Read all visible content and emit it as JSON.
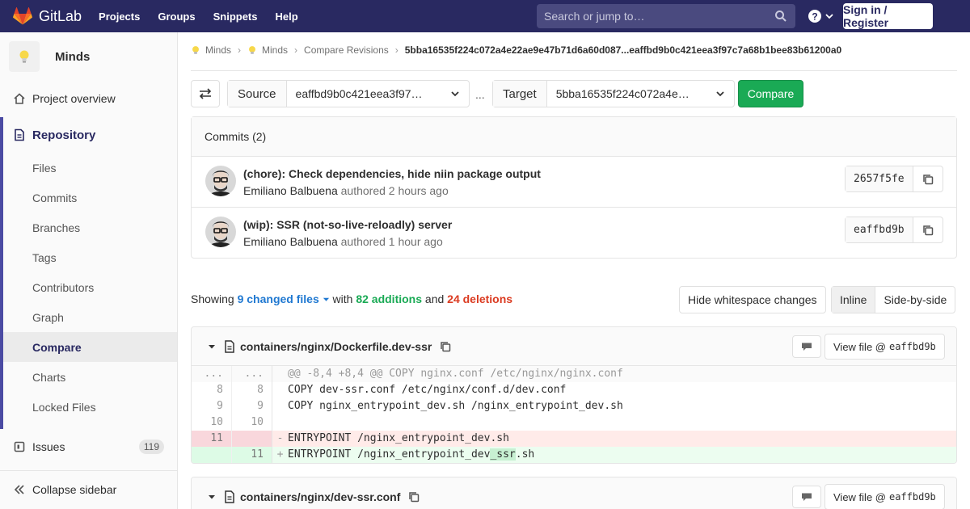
{
  "topbar": {
    "brand": "GitLab",
    "nav": [
      "Projects",
      "Groups",
      "Snippets",
      "Help"
    ],
    "search_placeholder": "Search or jump to…",
    "signin": "Sign in / Register"
  },
  "sidebar": {
    "project": "Minds",
    "overview": "Project overview",
    "repository": "Repository",
    "repo_items": [
      "Files",
      "Commits",
      "Branches",
      "Tags",
      "Contributors",
      "Graph",
      "Compare",
      "Charts",
      "Locked Files"
    ],
    "active_item": "Compare",
    "issues": "Issues",
    "issues_count": "119",
    "collapse": "Collapse sidebar"
  },
  "breadcrumbs": {
    "items": [
      "Minds",
      "Minds",
      "Compare Revisions"
    ],
    "current": "5bba16535f224c072a4e22ae9e47b71d6a60d087...eaffbd9b0c421eea3f97c7a68b1bee83b61200a0"
  },
  "compare": {
    "source_label": "Source",
    "source_value": "eaffbd9b0c421eea3f97…",
    "separator": "...",
    "target_label": "Target",
    "target_value": "5bba16535f224c072a4e…",
    "button": "Compare"
  },
  "commits": {
    "header": "Commits (2)",
    "list": [
      {
        "title": "(chore): Check dependencies, hide niin package output",
        "author": "Emiliano Balbuena",
        "meta": "authored 2 hours ago",
        "sha": "2657f5fe"
      },
      {
        "title": "(wip): SSR (not-so-live-reloadly) server",
        "author": "Emiliano Balbuena",
        "meta": "authored 1 hour ago",
        "sha": "eaffbd9b"
      }
    ]
  },
  "summary": {
    "showing": "Showing",
    "changed": "9 changed files",
    "with": "with",
    "additions": "82 additions",
    "and": "and",
    "deletions": "24 deletions",
    "whitespace": "Hide whitespace changes",
    "inline": "Inline",
    "side_by_side": "Side-by-side"
  },
  "files": [
    {
      "path": "containers/nginx/Dockerfile.dev-ssr",
      "view_label": "View file @",
      "view_sha": "eaffbd9b",
      "lines": [
        {
          "type": "meta",
          "old": "...",
          "new": "...",
          "mark": "",
          "code": "@@ -8,4 +8,4 @@ COPY nginx.conf /etc/nginx/nginx.conf"
        },
        {
          "type": "ctx",
          "old": "8",
          "new": "8",
          "mark": "",
          "code": "COPY dev-ssr.conf /etc/nginx/conf.d/dev.conf"
        },
        {
          "type": "ctx",
          "old": "9",
          "new": "9",
          "mark": "",
          "code": "COPY nginx_entrypoint_dev.sh /nginx_entrypoint_dev.sh"
        },
        {
          "type": "ctx",
          "old": "10",
          "new": "10",
          "mark": "",
          "code": ""
        },
        {
          "type": "old",
          "old": "11",
          "new": "",
          "mark": "-",
          "code": "ENTRYPOINT /nginx_entrypoint_dev.sh"
        },
        {
          "type": "new",
          "old": "",
          "new": "11",
          "mark": "+",
          "code_pre": "ENTRYPOINT /nginx_entrypoint_dev",
          "code_hl": "_ssr",
          "code_post": ".sh"
        }
      ]
    },
    {
      "path": "containers/nginx/dev-ssr.conf",
      "view_label": "View file @",
      "view_sha": "eaffbd9b"
    }
  ]
}
